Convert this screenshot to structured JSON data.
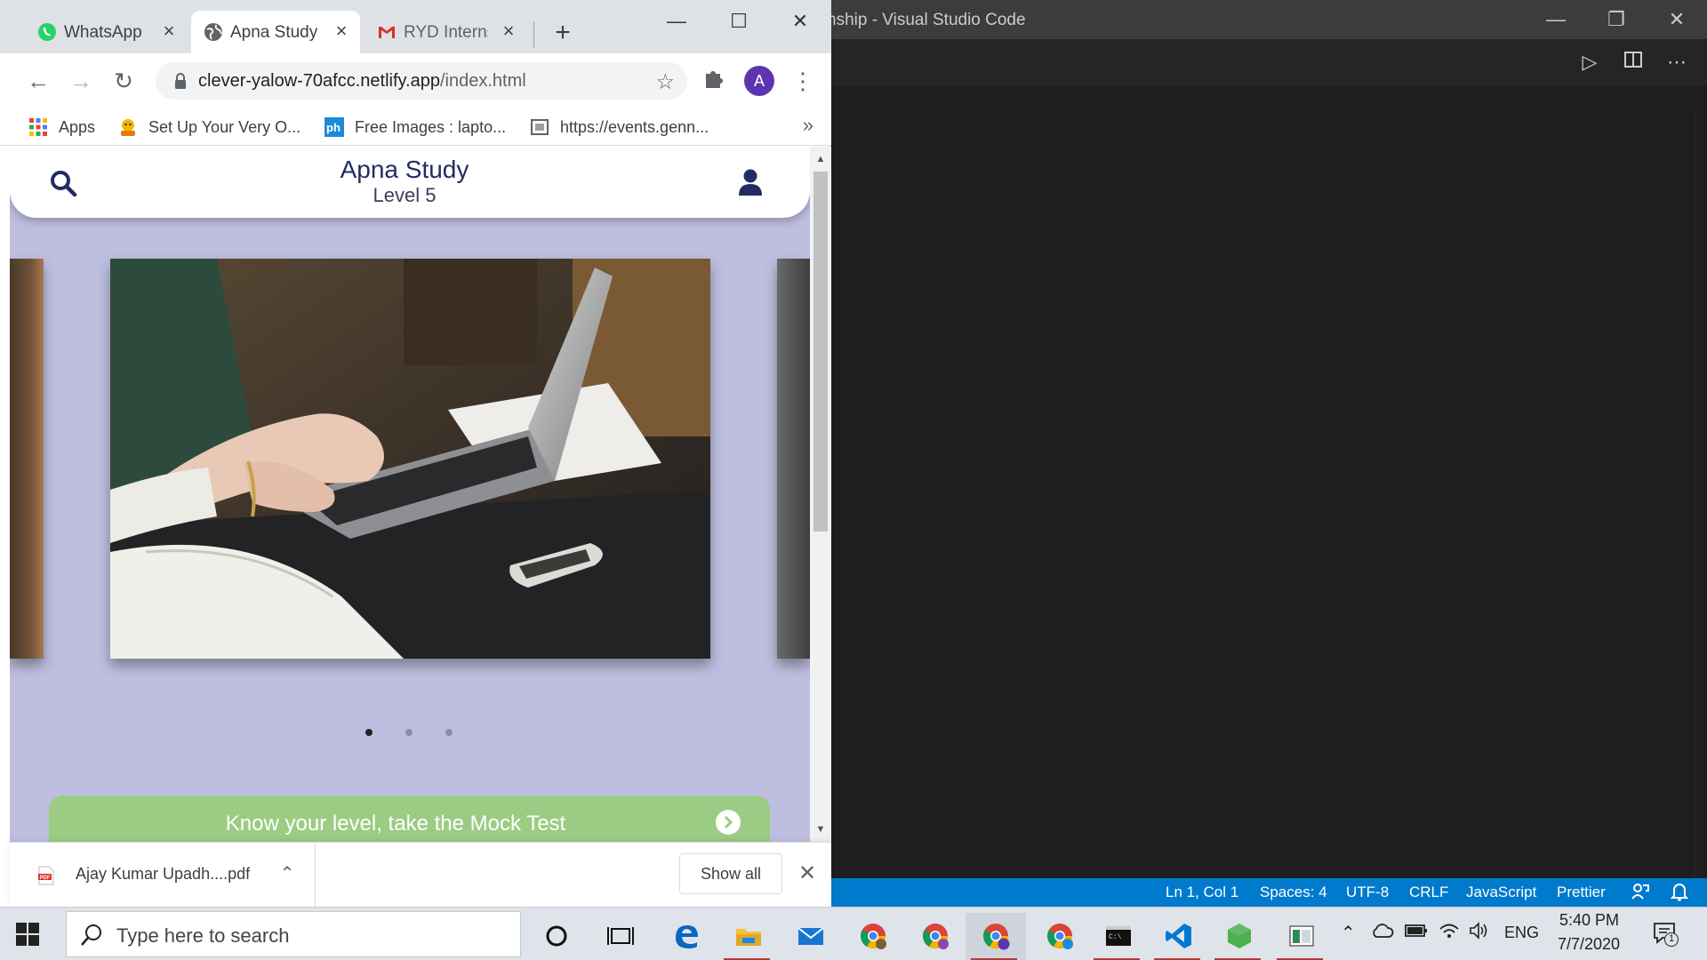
{
  "vscode": {
    "window_title": "nship - Visual Studio Code",
    "status": {
      "position": "Ln 1, Col 1",
      "spaces": "Spaces: 4",
      "encoding": "UTF-8",
      "eol": "CRLF",
      "language": "JavaScript",
      "formatter": "Prettier"
    },
    "statusbar_color": "#007acc"
  },
  "chrome": {
    "tabs": [
      {
        "label": "WhatsApp",
        "icon": "whatsapp-icon"
      },
      {
        "label": "Apna Study",
        "icon": "globe-icon",
        "active": true
      },
      {
        "label": "RYD Internshi",
        "icon": "gmail-icon"
      }
    ],
    "url_host": "clever-yalow-70afcc.netlify.app",
    "url_path": "/index.html",
    "profile_initial": "A",
    "bookmarks": [
      {
        "label": "Apps",
        "icon": "apps-grid-icon"
      },
      {
        "label": "Set Up Your Very O...",
        "icon": "person-emoji-icon"
      },
      {
        "label": "Free Images : lapto...",
        "icon": "ph-icon"
      },
      {
        "label": "https://events.genn...",
        "icon": "page-icon"
      }
    ],
    "bookmarks_more": "»"
  },
  "site": {
    "title": "Apna Study",
    "level": "Level 5",
    "carousel_dots": 3,
    "active_dot": 0,
    "cta_text": "Know your level, take the Mock Test",
    "colors": {
      "background": "#bebee0",
      "title": "#232c62",
      "cta": "#9ccc84"
    }
  },
  "downloads": {
    "file_name": "Ajay Kumar Upadh....pdf",
    "show_all": "Show all"
  },
  "taskbar": {
    "search_placeholder": "Type here to search",
    "language": "ENG",
    "time": "5:40 PM",
    "date": "7/7/2020",
    "notification_count": "1"
  }
}
